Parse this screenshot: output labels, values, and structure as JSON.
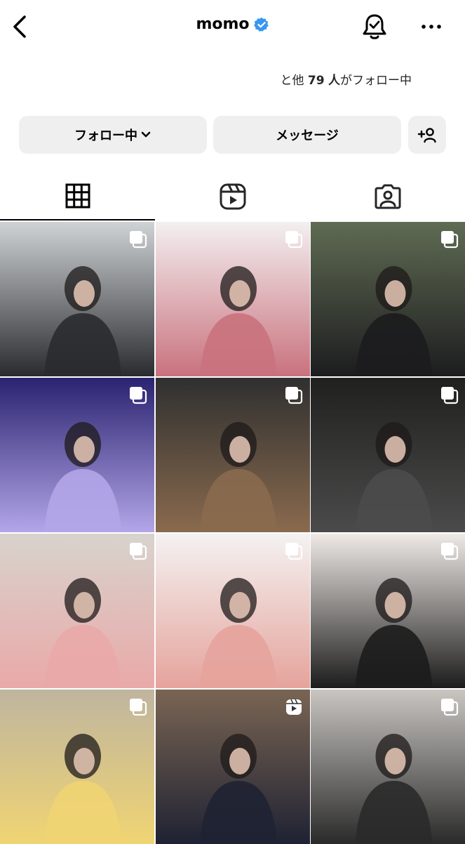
{
  "header": {
    "title": "momo",
    "verified": true
  },
  "followers": {
    "prefix": "と他",
    "count": "79",
    "count_suffix": "人",
    "suffix": "がフォロー中"
  },
  "actions": {
    "follow_label": "フォロー中",
    "message_label": "メッセージ"
  },
  "tabs": [
    {
      "name": "posts",
      "icon": "grid-icon",
      "active": true
    },
    {
      "name": "reels",
      "icon": "reels-icon",
      "active": false
    },
    {
      "name": "tagged",
      "icon": "tagged-icon",
      "active": false
    }
  ],
  "posts": [
    {
      "badge": "carousel",
      "colors": [
        "#cfd3d6",
        "#2a2b2f"
      ]
    },
    {
      "badge": "carousel",
      "colors": [
        "#f3eff0",
        "#c9727d"
      ]
    },
    {
      "badge": "carousel",
      "colors": [
        "#5f6b53",
        "#1c1c1e"
      ]
    },
    {
      "badge": "carousel",
      "colors": [
        "#2a2370",
        "#b3a6e8"
      ]
    },
    {
      "badge": "carousel",
      "colors": [
        "#2f3030",
        "#8a6a4e"
      ]
    },
    {
      "badge": "carousel",
      "colors": [
        "#20201f",
        "#4b4b4b"
      ]
    },
    {
      "badge": "carousel",
      "colors": [
        "#d8d3cd",
        "#e9a9a8"
      ]
    },
    {
      "badge": "carousel",
      "colors": [
        "#f4f2f1",
        "#e5a39c"
      ]
    },
    {
      "badge": "carousel",
      "colors": [
        "#efeae6",
        "#1c1c1c"
      ]
    },
    {
      "badge": "carousel",
      "colors": [
        "#bfb59f",
        "#f0d473"
      ]
    },
    {
      "badge": "reel",
      "colors": [
        "#7a6553",
        "#1f2233"
      ]
    },
    {
      "badge": "carousel",
      "colors": [
        "#c9c6c2",
        "#2a2a2a"
      ]
    }
  ],
  "colors": {
    "verified": "#3897f0",
    "button_bg": "#efefef",
    "text": "#000000"
  }
}
